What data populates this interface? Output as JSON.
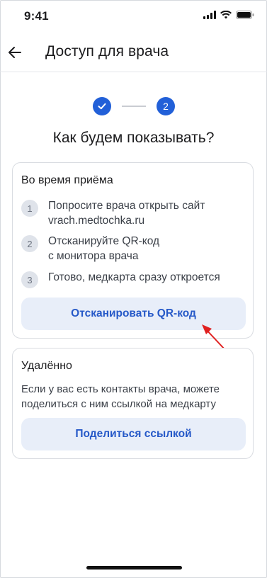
{
  "status_bar": {
    "time": "9:41"
  },
  "header": {
    "title": "Доступ для врача"
  },
  "stepper": {
    "step2_label": "2"
  },
  "heading": "Как будем показывать?",
  "in_person": {
    "title": "Во время приёма",
    "steps": [
      {
        "num": "1",
        "text_line1": "Попросите врача открыть сайт",
        "text_line2": "vrach.medtochka.ru"
      },
      {
        "num": "2",
        "text_line1": "Отсканируйте QR-код",
        "text_line2": "с монитора врача"
      },
      {
        "num": "3",
        "text_line1": "Готово, медкарта сразу откроется"
      }
    ],
    "button_label": "Отсканировать QR-код"
  },
  "remote": {
    "title": "Удалённо",
    "text": "Если у вас есть контакты врача, можете поделиться с ним ссылкой на медкарту",
    "button_label": "Поделиться ссылкой"
  },
  "colors": {
    "accent": "#2260d8",
    "button_bg": "#e8eef9",
    "annotation_arrow": "#e02020"
  }
}
